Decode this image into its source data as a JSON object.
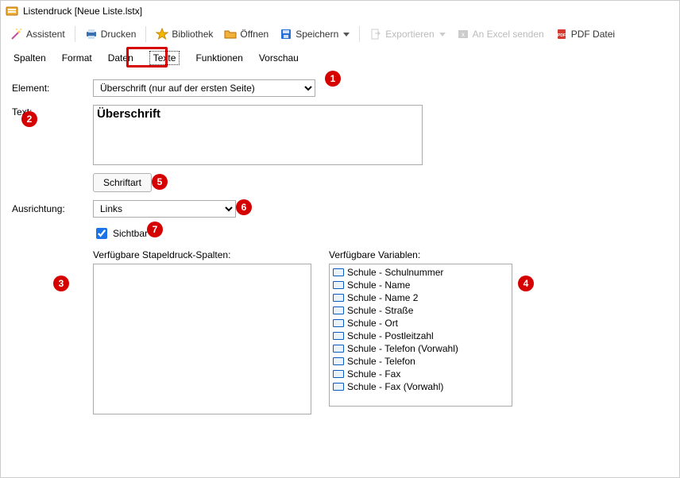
{
  "window": {
    "title": "Listendruck [Neue Liste.lstx]"
  },
  "toolbar": {
    "assistent_label": "Assistent",
    "drucken_label": "Drucken",
    "bibliothek_label": "Bibliothek",
    "oeffnen_label": "Öffnen",
    "speichern_label": "Speichern",
    "exportieren_label": "Exportieren",
    "excel_label": "An Excel senden",
    "pdf_label": "PDF Datei"
  },
  "tabs": {
    "items": [
      {
        "label": "Spalten"
      },
      {
        "label": "Format"
      },
      {
        "label": "Daten"
      },
      {
        "label": "Texte"
      },
      {
        "label": "Funktionen"
      },
      {
        "label": "Vorschau"
      }
    ],
    "active_index": 3
  },
  "form": {
    "element_label": "Element:",
    "element_value": "Überschrift (nur auf der ersten Seite)",
    "text_label": "Text:",
    "text_value": "Überschrift",
    "schriftart_label": "Schriftart",
    "ausrichtung_label": "Ausrichtung:",
    "ausrichtung_value": "Links",
    "sichtbar_label": "Sichtbar",
    "sichtbar_checked": true
  },
  "lists": {
    "stapel_label": "Verfügbare Stapeldruck-Spalten:",
    "variablen_label": "Verfügbare Variablen:",
    "variablen": [
      {
        "label": "Schule - Schulnummer"
      },
      {
        "label": "Schule - Name"
      },
      {
        "label": "Schule - Name 2"
      },
      {
        "label": "Schule - Straße"
      },
      {
        "label": "Schule - Ort"
      },
      {
        "label": "Schule - Postleitzahl"
      },
      {
        "label": "Schule - Telefon (Vorwahl)"
      },
      {
        "label": "Schule - Telefon"
      },
      {
        "label": "Schule - Fax"
      },
      {
        "label": "Schule - Fax (Vorwahl)"
      }
    ]
  },
  "badges": {
    "b1": "1",
    "b2": "2",
    "b3": "3",
    "b4": "4",
    "b5": "5",
    "b6": "6",
    "b7": "7"
  },
  "colors": {
    "highlight": "#d50000",
    "select_blue": "#1a73e8"
  }
}
